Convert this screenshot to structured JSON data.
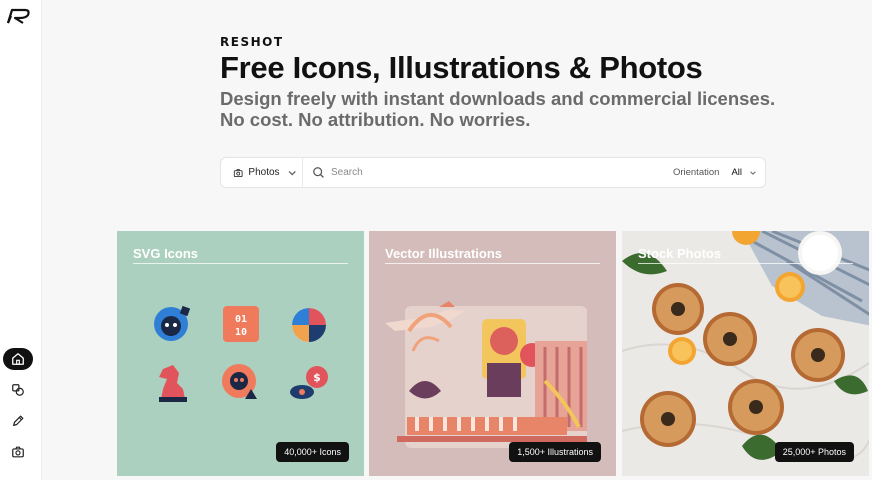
{
  "sidebar": {
    "logo": "reshot-logo",
    "items": [
      {
        "name": "home",
        "icon": "home-icon",
        "active": true
      },
      {
        "name": "icons",
        "icon": "shapes-icon",
        "active": false
      },
      {
        "name": "illustrations",
        "icon": "pencil-icon",
        "active": false
      },
      {
        "name": "photos",
        "icon": "camera-icon",
        "active": false
      }
    ]
  },
  "hero": {
    "brand": "RESHOT",
    "title": "Free Icons, Illustrations & Photos",
    "subtitle_line1": "Design freely with instant downloads and commercial licenses.",
    "subtitle_line2": "No cost. No attribution. No worries."
  },
  "search": {
    "type_value": "Photos",
    "placeholder": "Search",
    "orientation_label": "Orientation",
    "orientation_value": "All"
  },
  "cards": [
    {
      "title": "SVG Icons",
      "badge": "40,000+ Icons",
      "color": "#acd0c0"
    },
    {
      "title": "Vector Illustrations",
      "badge": "1,500+ Illustrations",
      "color": "#d4bcba"
    },
    {
      "title": "Stock Photos",
      "badge": "25,000+ Photos",
      "color": "#ececec"
    }
  ]
}
